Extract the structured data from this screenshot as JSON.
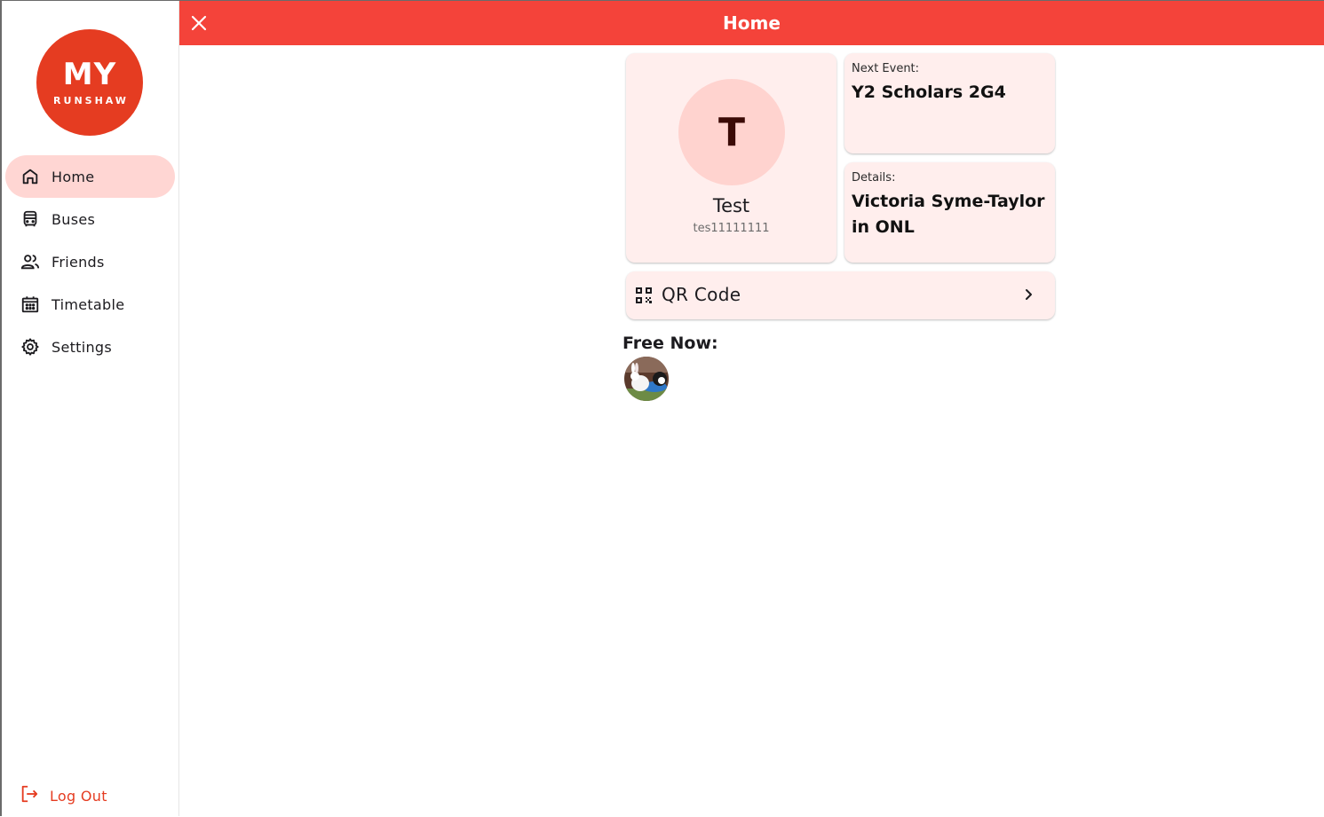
{
  "app": {
    "logo_big": "MY",
    "logo_small": "RUNSHAW",
    "header_title": "Home"
  },
  "sidebar": {
    "items": [
      {
        "label": "Home",
        "icon": "home-icon",
        "active": true
      },
      {
        "label": "Buses",
        "icon": "bus-icon",
        "active": false
      },
      {
        "label": "Friends",
        "icon": "friends-icon",
        "active": false
      },
      {
        "label": "Timetable",
        "icon": "calendar-icon",
        "active": false
      },
      {
        "label": "Settings",
        "icon": "gear-icon",
        "active": false
      }
    ],
    "logout_label": "Log Out"
  },
  "profile": {
    "initial": "T",
    "name": "Test",
    "username": "tes11111111"
  },
  "next_event": {
    "caption": "Next Event:",
    "value": "Y2 Scholars 2G4"
  },
  "details": {
    "caption": "Details:",
    "value": "Victoria Syme-Taylor in ONL"
  },
  "qr": {
    "label": "QR Code"
  },
  "free_now": {
    "title": "Free Now:"
  },
  "colors": {
    "brand": "#f4433a",
    "logo": "#e53c21",
    "card": "#ffeeed",
    "active_nav": "#ffd6d3"
  }
}
